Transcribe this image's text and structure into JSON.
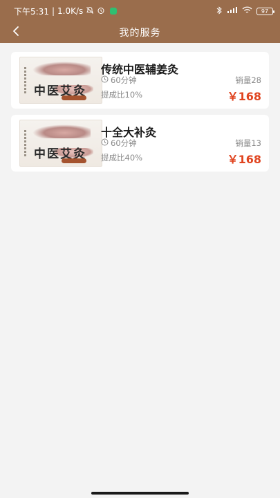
{
  "status_bar": {
    "time": "下午5:31",
    "network_speed": "1.0K/s",
    "separator": "|",
    "battery": "97",
    "icons": [
      "mute-bell-icon",
      "alarm-icon",
      "app-notification-icon",
      "bluetooth-icon",
      "signal-icon",
      "wifi-icon",
      "battery-icon"
    ]
  },
  "header": {
    "title": "我的服务",
    "back_icon": "back-chevron-icon",
    "background": "#9a6d4c"
  },
  "services": [
    {
      "name": "传统中医辅姜灸",
      "duration": "60分钟",
      "commission": "提成比10%",
      "sales": "销量28",
      "price": "￥168"
    },
    {
      "name": "十全大补灸",
      "duration": "60分钟",
      "commission": "提成比40%",
      "sales": "销量13",
      "price": "￥168"
    }
  ],
  "thumbnail_art_text": "中医艾灸",
  "colors": {
    "price": "#e0441f",
    "muted_text": "#888888",
    "page_bg": "#f3f3f3"
  }
}
